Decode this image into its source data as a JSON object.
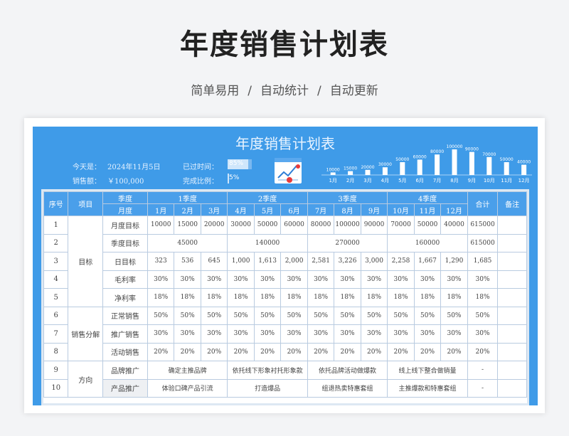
{
  "hero": {
    "title": "年度销售计划表",
    "subtitle_parts": [
      "简单易用",
      "/",
      "自动统计",
      "/",
      "自动更新"
    ]
  },
  "sheet": {
    "title": "年度销售计划表",
    "today_label": "今天是：",
    "today_value": "2024年11月5日",
    "sales_label": "销售额：",
    "sales_value": "￥100,000",
    "elapsed_label": "已过时间：",
    "elapsed_value": "85%",
    "elapsed_fraction": 0.85,
    "completion_label": "完成比例：",
    "completion_value": "5%",
    "completion_fraction": 0.05
  },
  "chart_data": {
    "type": "bar",
    "categories": [
      "1月",
      "2月",
      "3月",
      "4月",
      "5月",
      "6月",
      "7月",
      "8月",
      "9月",
      "10月",
      "11月",
      "12月"
    ],
    "values": [
      10000,
      15000,
      20000,
      30000,
      50000,
      60000,
      80000,
      100000,
      90000,
      70000,
      50000,
      40000
    ],
    "ylim": [
      0,
      100000
    ],
    "data_labels": true
  },
  "table": {
    "header_top": {
      "seq": "序号",
      "item": "项目",
      "season": "季度",
      "q1": "1季度",
      "q2": "2季度",
      "q3": "3季度",
      "q4": "4季度",
      "total": "合计",
      "note": "备注"
    },
    "header_month_label": "月度",
    "months": [
      "1月",
      "2月",
      "3月",
      "4月",
      "5月",
      "6月",
      "7月",
      "8月",
      "9月",
      "10月",
      "11月",
      "12月"
    ],
    "groups": {
      "target": "目标",
      "split": "销售分解",
      "direction": "方向"
    },
    "rows": [
      {
        "no": "1",
        "label": "月度目标",
        "cells": [
          "10000",
          "15000",
          "20000",
          "30000",
          "50000",
          "60000",
          "80000",
          "100000",
          "90000",
          "70000",
          "50000",
          "40000"
        ],
        "total": "615000"
      },
      {
        "no": "2",
        "label": "季度目标",
        "quarters": [
          "45000",
          "140000",
          "270000",
          "160000"
        ],
        "total": "615000"
      },
      {
        "no": "3",
        "label": "日目标",
        "cells": [
          "323",
          "536",
          "645",
          "1,000",
          "1,613",
          "2,000",
          "2,581",
          "3,226",
          "3,000",
          "2,258",
          "1,667",
          "1,290"
        ],
        "total": "1,685"
      },
      {
        "no": "4",
        "label": "毛利率",
        "cells": [
          "30%",
          "30%",
          "30%",
          "30%",
          "30%",
          "30%",
          "30%",
          "30%",
          "30%",
          "30%",
          "30%",
          "30%"
        ],
        "total": "30%"
      },
      {
        "no": "5",
        "label": "净利率",
        "cells": [
          "18%",
          "18%",
          "18%",
          "18%",
          "18%",
          "18%",
          "18%",
          "18%",
          "18%",
          "18%",
          "18%",
          "18%"
        ],
        "total": "18%"
      },
      {
        "no": "6",
        "label": "正常销售",
        "cells": [
          "50%",
          "50%",
          "50%",
          "50%",
          "50%",
          "50%",
          "50%",
          "50%",
          "50%",
          "50%",
          "50%",
          "50%"
        ],
        "total": "50%"
      },
      {
        "no": "7",
        "label": "推广销售",
        "cells": [
          "30%",
          "30%",
          "30%",
          "30%",
          "30%",
          "30%",
          "30%",
          "30%",
          "30%",
          "30%",
          "30%",
          "30%"
        ],
        "total": "30%"
      },
      {
        "no": "8",
        "label": "活动销售",
        "cells": [
          "20%",
          "20%",
          "20%",
          "20%",
          "20%",
          "20%",
          "20%",
          "20%",
          "20%",
          "20%",
          "20%",
          "20%"
        ],
        "total": "20%"
      },
      {
        "no": "9",
        "label": "品牌推广",
        "quarters": [
          "确定主推品牌",
          "依托线下形象衬托形象款",
          "依托品牌活动做爆款",
          "线上线下整合做销量"
        ],
        "total": "-"
      },
      {
        "no": "10",
        "label": "产品推广",
        "quarters": [
          "体验口碑产品引流",
          "打造爆品",
          "组退热卖特惠套组",
          "主推爆款和特惠套组"
        ],
        "total": "-"
      }
    ]
  }
}
